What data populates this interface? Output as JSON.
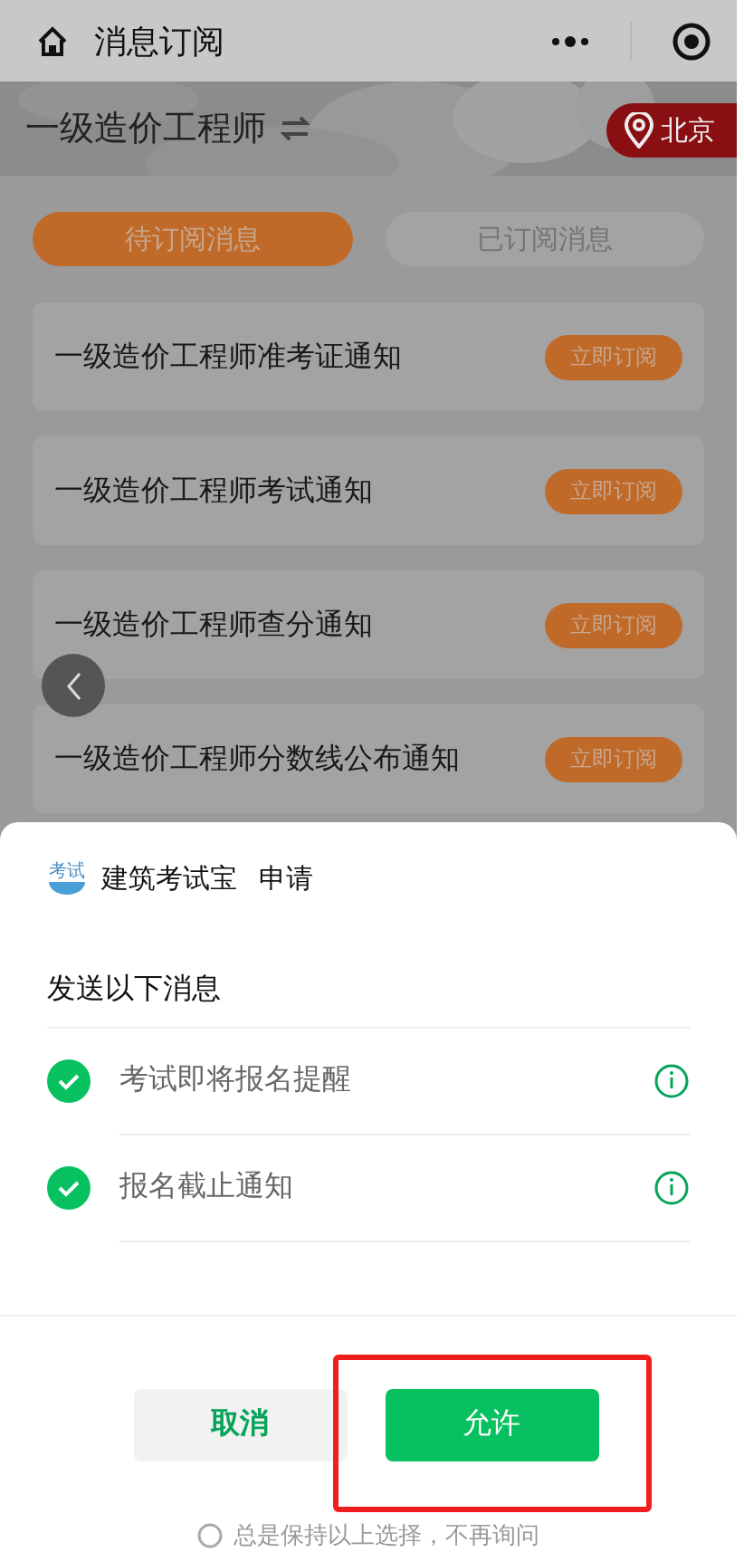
{
  "nav": {
    "title": "消息订阅"
  },
  "banner": {
    "category": "一级造价工程师",
    "location": "北京"
  },
  "tabs": [
    {
      "label": "待订阅消息",
      "selected": true
    },
    {
      "label": "已订阅消息",
      "selected": false
    }
  ],
  "items": [
    {
      "title": "一级造价工程师准考证通知",
      "action": "立即订阅"
    },
    {
      "title": "一级造价工程师考试通知",
      "action": "立即订阅"
    },
    {
      "title": "一级造价工程师查分通知",
      "action": "立即订阅"
    },
    {
      "title": "一级造价工程师分数线公布通知",
      "action": "立即订阅"
    }
  ],
  "sheet": {
    "app_logo": "考试",
    "app_name": "建筑考试宝",
    "request": "申请",
    "heading": "发送以下消息",
    "messages": [
      {
        "label": "考试即将报名提醒",
        "checked": true
      },
      {
        "label": "报名截止通知",
        "checked": true
      }
    ],
    "cancel": "取消",
    "allow": {
      "label": "允许",
      "highlighted": true
    },
    "remember": {
      "label": "总是保持以上选择，不再询问",
      "checked": false
    }
  }
}
